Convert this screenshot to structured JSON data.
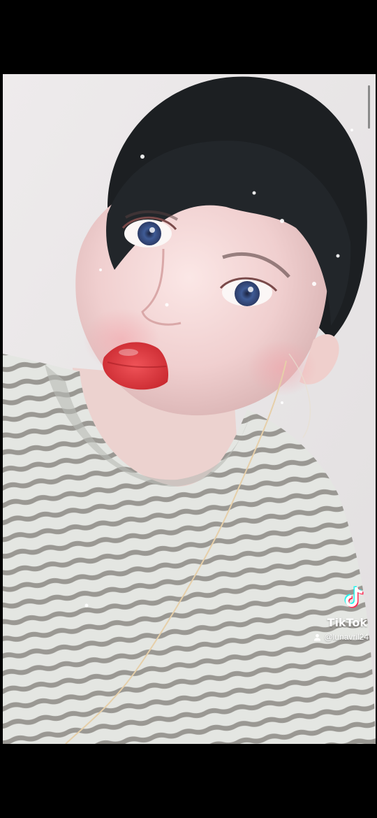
{
  "watermark": {
    "brand": "TikTok",
    "username": "@lunavril24",
    "icons": [
      "tiktok-logo-icon",
      "user-icon"
    ]
  },
  "colors": {
    "background": "#000000",
    "tiktok_cyan": "#25f4ee",
    "tiktok_red": "#fe2c55"
  }
}
